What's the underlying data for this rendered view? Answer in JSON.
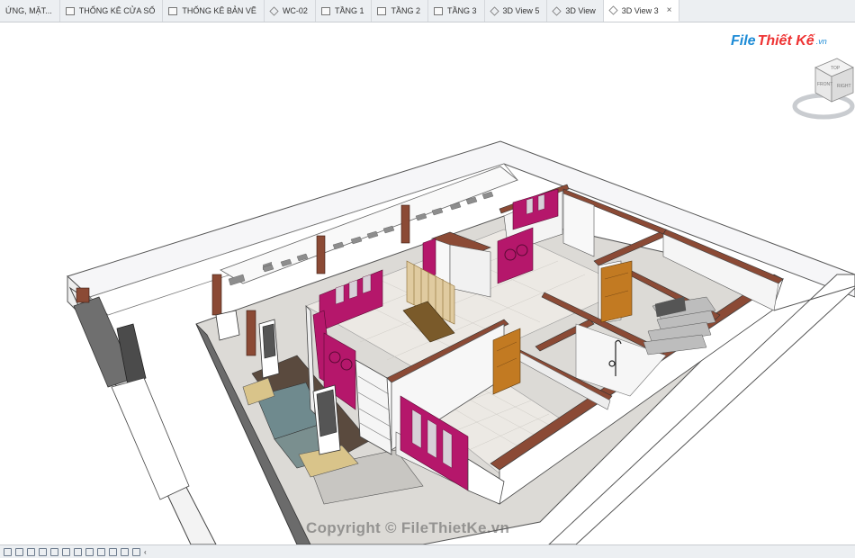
{
  "tabs": [
    {
      "label": "ỨNG, MẶT...",
      "icon": "none"
    },
    {
      "label": "THỐNG KÊ CỬA SỔ",
      "icon": "schedule-icon"
    },
    {
      "label": "THỐNG KÊ BẢN VẼ",
      "icon": "schedule-icon"
    },
    {
      "label": "WC-02",
      "icon": "3d-view-icon"
    },
    {
      "label": "TẦNG 1",
      "icon": "floor-plan-icon"
    },
    {
      "label": "TẦNG 2",
      "icon": "floor-plan-icon"
    },
    {
      "label": "TẦNG 3",
      "icon": "floor-plan-icon"
    },
    {
      "label": "3D View 5",
      "icon": "3d-view-icon"
    },
    {
      "label": "3D View",
      "icon": "3d-view-icon"
    },
    {
      "label": "3D View 3",
      "icon": "3d-view-icon"
    }
  ],
  "active_tab": "3D View 3",
  "logo": {
    "part1": "File",
    "part2": "Thiết Kế",
    "part3": ".vn"
  },
  "viewcube": {
    "top": "TOP",
    "front": "FRONT",
    "right": "RIGHT"
  },
  "watermark": "Copyright © FileThietKe.vn",
  "status": {
    "scroll_arrow": "‹"
  },
  "colors": {
    "wall_cap": "#8b4a35",
    "door_frame": "#b5176b",
    "wood_door": "#c27a22",
    "floor_tile": "#ece9e4"
  }
}
